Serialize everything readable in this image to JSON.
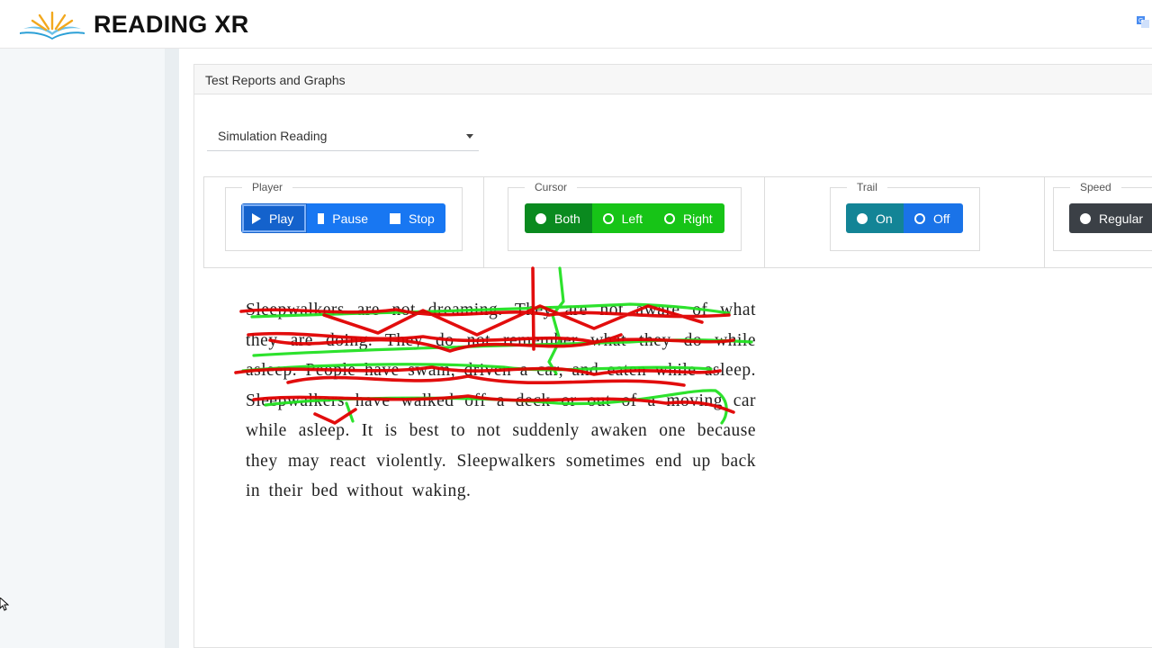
{
  "header": {
    "brand": "READING XR",
    "logo_icon": "open-book-logo-icon",
    "translate_icon": "translate-icon"
  },
  "card": {
    "title": "Test Reports and Graphs"
  },
  "select": {
    "value": "Simulation Reading"
  },
  "player": {
    "legend": "Player",
    "buttons": [
      {
        "label": "Play",
        "icon": "play-icon",
        "active": true
      },
      {
        "label": "Pause",
        "icon": "pause-icon",
        "active": false
      },
      {
        "label": "Stop",
        "icon": "stop-icon",
        "active": false
      }
    ]
  },
  "cursor_group": {
    "legend": "Cursor",
    "options": [
      {
        "label": "Both",
        "selected": true
      },
      {
        "label": "Left",
        "selected": false
      },
      {
        "label": "Right",
        "selected": false
      }
    ]
  },
  "trail": {
    "legend": "Trail",
    "options": [
      {
        "label": "On",
        "selected": true
      },
      {
        "label": "Off",
        "selected": false
      }
    ]
  },
  "speed": {
    "legend": "Speed",
    "options": [
      {
        "label": "Regular",
        "selected": false
      }
    ]
  },
  "reading_text": "Sleepwalkers are not dreaming. They are not aware of what they are doing. They do not remember what they do while asleep. People have swam, driven a car, and eaten while asleep. Sleepwalkers have walked off a deck or out of a moving car while asleep. It is best to not suddenly awaken one because they may react violently. Sleepwalkers sometimes end up back in their bed without waking.",
  "colors": {
    "play_blue": "#1877f2",
    "cursor_green": "#17c417",
    "cursor_active_green": "#0a8a1f",
    "trail_teal": "#138496",
    "speed_dark": "#3b4046",
    "left_eye_trail": "#e00000",
    "right_eye_trail": "#22e022"
  }
}
